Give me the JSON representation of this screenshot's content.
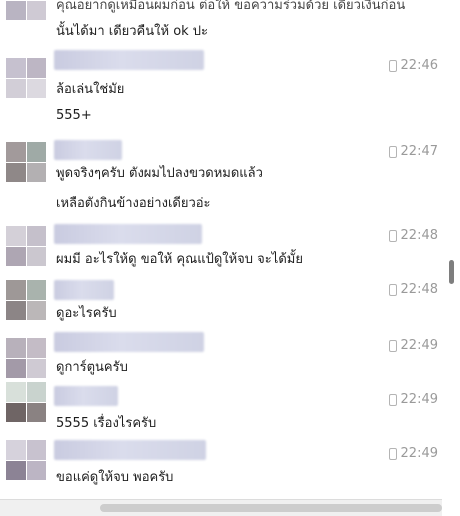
{
  "messages": [
    {
      "text_lines": [
        "คุณอยากดูเหมือนผมก่อน ต่อให้ ขอความร่วมด้วย เดี๋ยวเงินก่อน",
        "นั้นได้มา เดียวคืนให้ ok ปะ"
      ],
      "time": ""
    },
    {
      "text_lines": [
        "ล้อเล่นใช่มัย",
        "555+"
      ],
      "time": "22:46"
    },
    {
      "text_lines": [
        "พูดจริงๆครับ ตังผมไปลงขวดหมดแล้ว",
        "เหลือตังกินข้างอย่างเดียวอ่ะ"
      ],
      "time": "22:47"
    },
    {
      "text_lines": [
        "ผมมี อะไรให้ดู ขอให้ คุณแป้ดูให้จบ จะได้มั้ย"
      ],
      "time": "22:48"
    },
    {
      "text_lines": [
        "ดูอะไรครับ"
      ],
      "time": "22:48"
    },
    {
      "text_lines": [
        "ดูการ์ตูนครับ"
      ],
      "time": "22:49"
    },
    {
      "text_lines": [
        "5555 เรื่องไรครับ"
      ],
      "time": "22:49"
    },
    {
      "text_lines": [
        "ขอแค่ดูให้จบ พอครับ"
      ],
      "time": "22:49"
    }
  ],
  "icons": {
    "time_icon": "phone-icon"
  },
  "colors": {
    "time_text": "#9a9a9a",
    "message_text": "#1d1d1d",
    "background": "#ffffff"
  }
}
